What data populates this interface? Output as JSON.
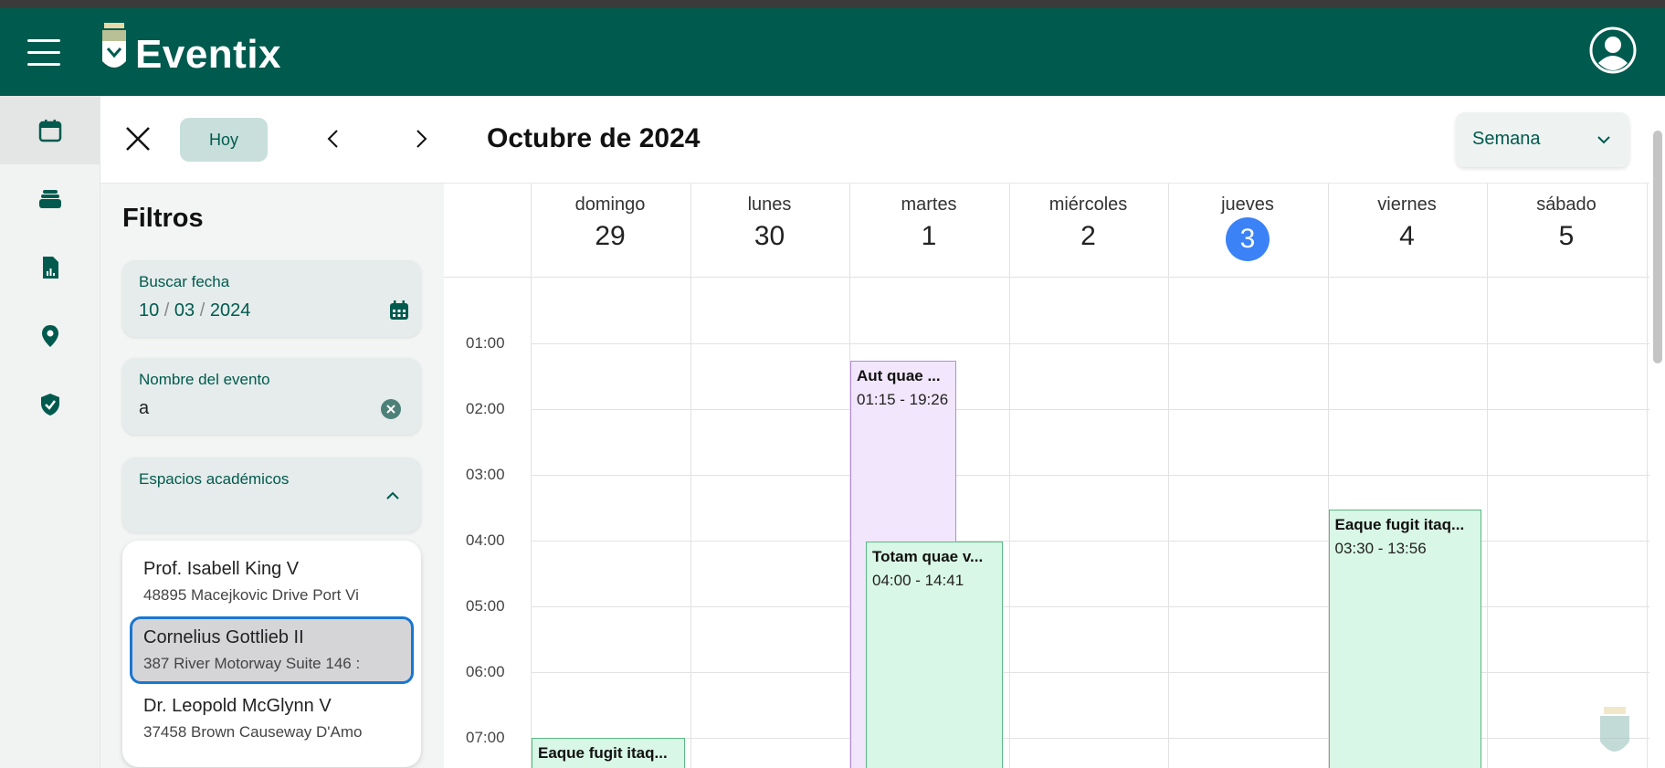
{
  "app": {
    "name": "Eventix"
  },
  "toolbar": {
    "today_label": "Hoy",
    "title": "Octubre de 2024",
    "view_select": "Semana"
  },
  "filters": {
    "heading": "Filtros",
    "date_field": {
      "label": "Buscar fecha",
      "value": "10/03/2024",
      "day": "10",
      "month": "03",
      "year": "2024"
    },
    "event_name_field": {
      "label": "Nombre del evento",
      "value": "a"
    },
    "spaces_field": {
      "label": "Espacios académicos"
    },
    "options": [
      {
        "name": "Prof. Isabell King V",
        "address": "48895 Macejkovic Drive Port Vi"
      },
      {
        "name": "Cornelius Gottlieb II",
        "address": "387 River Motorway Suite 146 :"
      },
      {
        "name": "Dr. Leopold McGlynn V",
        "address": "37458 Brown Causeway D'Amo"
      }
    ],
    "selected_option": 1
  },
  "calendar": {
    "days": [
      {
        "name": "domingo",
        "number": "29"
      },
      {
        "name": "lunes",
        "number": "30"
      },
      {
        "name": "martes",
        "number": "1"
      },
      {
        "name": "miércoles",
        "number": "2"
      },
      {
        "name": "jueves",
        "number": "3",
        "today": true
      },
      {
        "name": "viernes",
        "number": "4"
      },
      {
        "name": "sábado",
        "number": "5"
      }
    ],
    "times": [
      "01:00",
      "02:00",
      "03:00",
      "04:00",
      "05:00",
      "06:00",
      "07:00"
    ],
    "events": [
      {
        "title": "Aut quae ...",
        "time": "01:15 - 19:26",
        "day": 2,
        "color": "purple"
      },
      {
        "title": "Totam quae v...",
        "time": "04:00 - 14:41",
        "day": 2,
        "color": "green"
      },
      {
        "title": "Eaque fugit itaq...",
        "time": "03:30 - 13:56",
        "day": 5,
        "color": "green"
      },
      {
        "title": "Eaque fugit itaq...",
        "time": "",
        "day": 0,
        "color": "green"
      }
    ]
  },
  "colors": {
    "primary": "#005a4e",
    "today": "#3b82f6",
    "selection_border": "#1976d2"
  }
}
